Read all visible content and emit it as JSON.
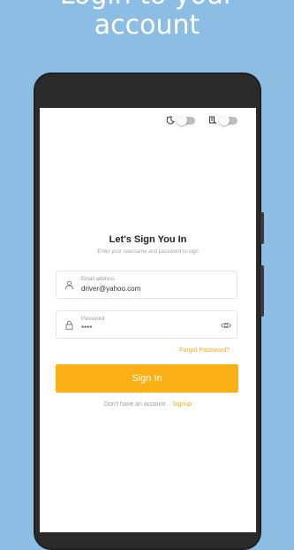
{
  "headline": {
    "line1": "Login to your",
    "line2": "account"
  },
  "status_toggles": [
    {
      "icon": "night-mode-icon",
      "state": "off"
    },
    {
      "icon": "language-icon",
      "state": "off"
    }
  ],
  "login": {
    "title": "Let's Sign You In",
    "subtitle": "Enter your username and password to sign",
    "email_label": "Email address",
    "email_value": "driver@yahoo.com",
    "password_label": "Password",
    "password_value": "****",
    "forgot_label": "Forgot Password?",
    "signin_label": "Sign In",
    "no_account_text": "Don't have an account",
    "signup_label": "Signup"
  },
  "colors": {
    "background": "#8cbde2",
    "accent": "#fbb016"
  }
}
